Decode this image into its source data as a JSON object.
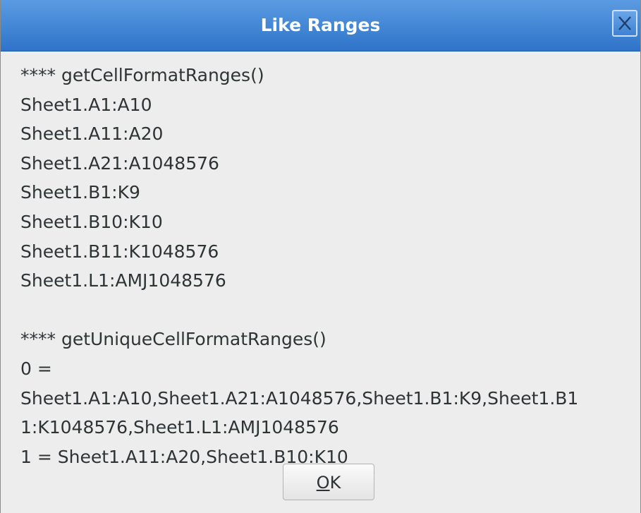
{
  "window": {
    "title": "Like Ranges"
  },
  "content": {
    "lines": [
      "**** getCellFormatRanges()",
      "Sheet1.A1:A10",
      "Sheet1.A11:A20",
      "Sheet1.A21:A1048576",
      "Sheet1.B1:K9",
      "Sheet1.B10:K10",
      "Sheet1.B11:K1048576",
      "Sheet1.L1:AMJ1048576",
      "",
      "**** getUniqueCellFormatRanges()",
      "0 =",
      "Sheet1.A1:A10,Sheet1.A21:A1048576,Sheet1.B1:K9,Sheet1.B1",
      "1:K1048576,Sheet1.L1:AMJ1048576",
      "1 = Sheet1.A11:A20,Sheet1.B10:K10"
    ]
  },
  "buttons": {
    "ok_mnemonic": "O",
    "ok_rest": "K"
  },
  "icons": {
    "close": "close-icon"
  }
}
